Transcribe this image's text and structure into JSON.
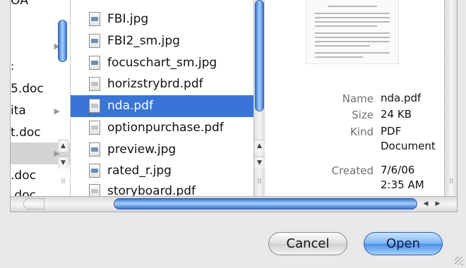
{
  "column1": {
    "rows": [
      {
        "label": "ОA",
        "arrow": false,
        "selected": false
      },
      {
        "label": "",
        "arrow": true,
        "selected": false
      },
      {
        "label": "",
        "arrow": false,
        "selected": false
      },
      {
        "label": "5.doc",
        "arrow": false,
        "selected": false
      },
      {
        "label": "ita",
        "arrow": true,
        "selected": false
      },
      {
        "label": "t.doc",
        "arrow": false,
        "selected": false
      },
      {
        "label": "",
        "arrow": true,
        "selected": true
      },
      {
        "label": ".doc",
        "arrow": false,
        "selected": false
      },
      {
        "label": ".doc",
        "arrow": false,
        "selected": false
      }
    ],
    "arrow_glyph": "▶"
  },
  "files": [
    {
      "name": "FBI.jpg",
      "type": "image",
      "selected": false
    },
    {
      "name": "FBI2_sm.jpg",
      "type": "image",
      "selected": false
    },
    {
      "name": "focuschart_sm.jpg",
      "type": "image",
      "selected": false
    },
    {
      "name": "horizstrybrd.pdf",
      "type": "pdf",
      "selected": false
    },
    {
      "name": "nda.pdf",
      "type": "pdf",
      "selected": true
    },
    {
      "name": "optionpurchase.pdf",
      "type": "pdf",
      "selected": false
    },
    {
      "name": "preview.jpg",
      "type": "image",
      "selected": false
    },
    {
      "name": "rated_r.jpg",
      "type": "image",
      "selected": false
    },
    {
      "name": "storyboard.pdf",
      "type": "pdf",
      "selected": false
    }
  ],
  "preview": {
    "name_label": "Name",
    "name_value": "nda.pdf",
    "size_label": "Size",
    "size_value": "24 KB",
    "kind_label": "Kind",
    "kind_value_1": "PDF",
    "kind_value_2": "Document",
    "created_label": "Created",
    "created_value_1": "7/6/06",
    "created_value_2": "2:35 AM"
  },
  "scroll": {
    "up_arrow": "▲",
    "down_arrow": "▼",
    "grip": "II",
    "left_arrow": "◀",
    "right_arrow": "▶"
  },
  "buttons": {
    "cancel": "Cancel",
    "open": "Open"
  },
  "colors": {
    "selection": "#3875d7",
    "accent": "#4b8ee8"
  }
}
